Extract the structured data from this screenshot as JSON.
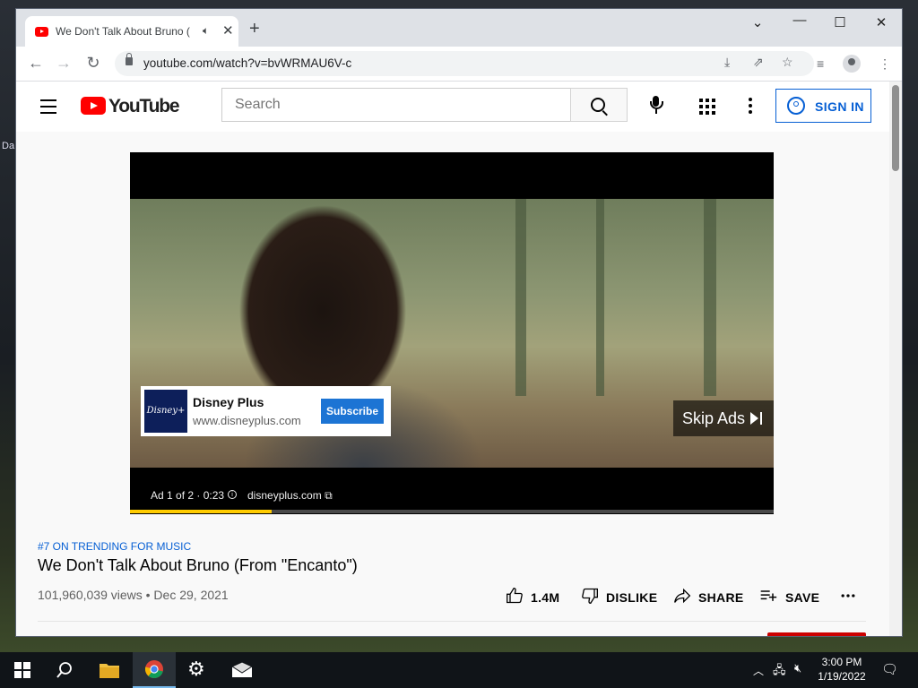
{
  "browser": {
    "tab_title": "We Don't Talk About Bruno (",
    "new_tab_glyph": "+",
    "url": "youtube.com/watch?v=bvWRMAU6V-c"
  },
  "desktop": {
    "icon_label": "Da"
  },
  "youtube": {
    "logo_text": "YouTube",
    "search_placeholder": "Search",
    "sign_in_label": "SIGN IN"
  },
  "ad": {
    "advertiser": "Disney Plus",
    "site": "www.disneyplus.com",
    "logo_text": "Disney+",
    "subscribe_label": "Subscribe",
    "skip_label": "Skip Ads",
    "counter": "Ad 1 of 2 · 0:23",
    "domain": "disneyplus.com",
    "progress_fraction": 0.22
  },
  "video": {
    "trending": "#7 ON TRENDING FOR MUSIC",
    "title": "We Don't Talk About Bruno (From \"Encanto\")",
    "views_date": "101,960,039 views • Dec 29, 2021",
    "like_count": "1.4M",
    "dislike_label": "DISLIKE",
    "share_label": "SHARE",
    "save_label": "SAVE"
  },
  "taskbar": {
    "time": "3:00 PM",
    "date": "1/19/2022"
  },
  "colors": {
    "youtube_red": "#ff0000",
    "link_blue": "#065fd4",
    "ad_progress": "#ffcc00",
    "subscribe_blue": "#1c74d4"
  }
}
